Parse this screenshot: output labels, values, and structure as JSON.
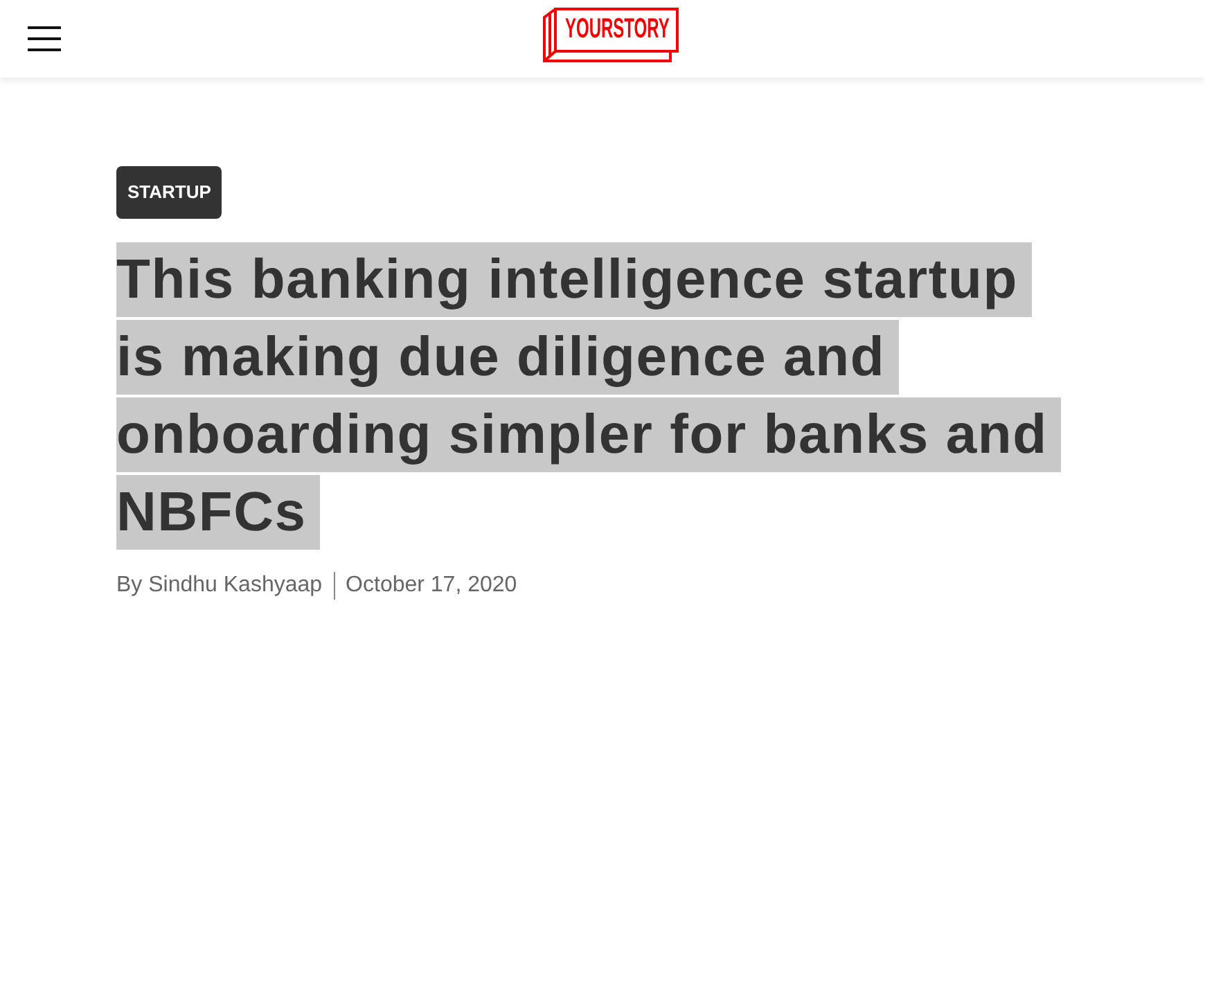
{
  "header": {
    "logo": "YOURSTORY"
  },
  "article": {
    "category": "STARTUP",
    "headline": {
      "text": "This banking intelligence startup is making due diligence and onboarding simpler for banks and NBFCs",
      "selected": true
    },
    "byline": {
      "author": "By Sindhu Kashyaap",
      "date": "October 17, 2020"
    }
  }
}
